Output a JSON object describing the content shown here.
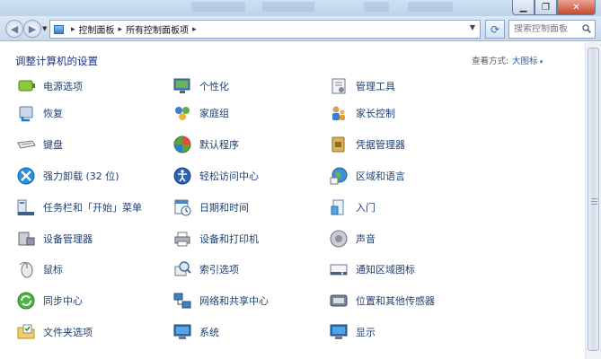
{
  "window": {
    "buttons": {
      "minimize_icon": "minimize-icon",
      "maximize_icon": "maximize-icon",
      "close_icon": "close-icon"
    }
  },
  "navbar": {
    "breadcrumb": [
      "控制面板",
      "所有控制面板项"
    ],
    "search_placeholder": "搜索控制面板"
  },
  "header": {
    "title": "调整计算机的设置",
    "view_label": "查看方式:",
    "view_value": "大图标"
  },
  "items": {
    "col1": [
      {
        "label": "电源选项",
        "icon": "power-options-icon"
      },
      {
        "label": "恢复",
        "icon": "recovery-icon"
      },
      {
        "label": "键盘",
        "icon": "keyboard-icon"
      },
      {
        "label": "强力卸载 (32 位)",
        "icon": "uninstaller-icon"
      },
      {
        "label": "任务栏和「开始」菜单",
        "icon": "taskbar-icon"
      },
      {
        "label": "设备管理器",
        "icon": "device-manager-icon"
      },
      {
        "label": "鼠标",
        "icon": "mouse-icon"
      },
      {
        "label": "同步中心",
        "icon": "sync-center-icon"
      },
      {
        "label": "文件夹选项",
        "icon": "folder-options-icon"
      }
    ],
    "col2": [
      {
        "label": "个性化",
        "icon": "personalization-icon"
      },
      {
        "label": "家庭组",
        "icon": "homegroup-icon"
      },
      {
        "label": "默认程序",
        "icon": "default-programs-icon"
      },
      {
        "label": "轻松访问中心",
        "icon": "ease-of-access-icon"
      },
      {
        "label": "日期和时间",
        "icon": "date-time-icon"
      },
      {
        "label": "设备和打印机",
        "icon": "devices-printers-icon"
      },
      {
        "label": "索引选项",
        "icon": "indexing-options-icon"
      },
      {
        "label": "网络和共享中心",
        "icon": "network-sharing-icon"
      },
      {
        "label": "系统",
        "icon": "system-icon"
      }
    ],
    "col3": [
      {
        "label": "管理工具",
        "icon": "admin-tools-icon"
      },
      {
        "label": "家长控制",
        "icon": "parental-controls-icon"
      },
      {
        "label": "凭据管理器",
        "icon": "credential-manager-icon"
      },
      {
        "label": "区域和语言",
        "icon": "region-language-icon"
      },
      {
        "label": "入门",
        "icon": "getting-started-icon"
      },
      {
        "label": "声音",
        "icon": "sound-icon"
      },
      {
        "label": "通知区域图标",
        "icon": "notification-icons-icon"
      },
      {
        "label": "位置和其他传感器",
        "icon": "location-sensors-icon"
      },
      {
        "label": "显示",
        "icon": "display-icon"
      }
    ]
  },
  "colors": {
    "link": "#1d3f74",
    "title": "#1e3287",
    "accent": "#2b5bb6"
  }
}
